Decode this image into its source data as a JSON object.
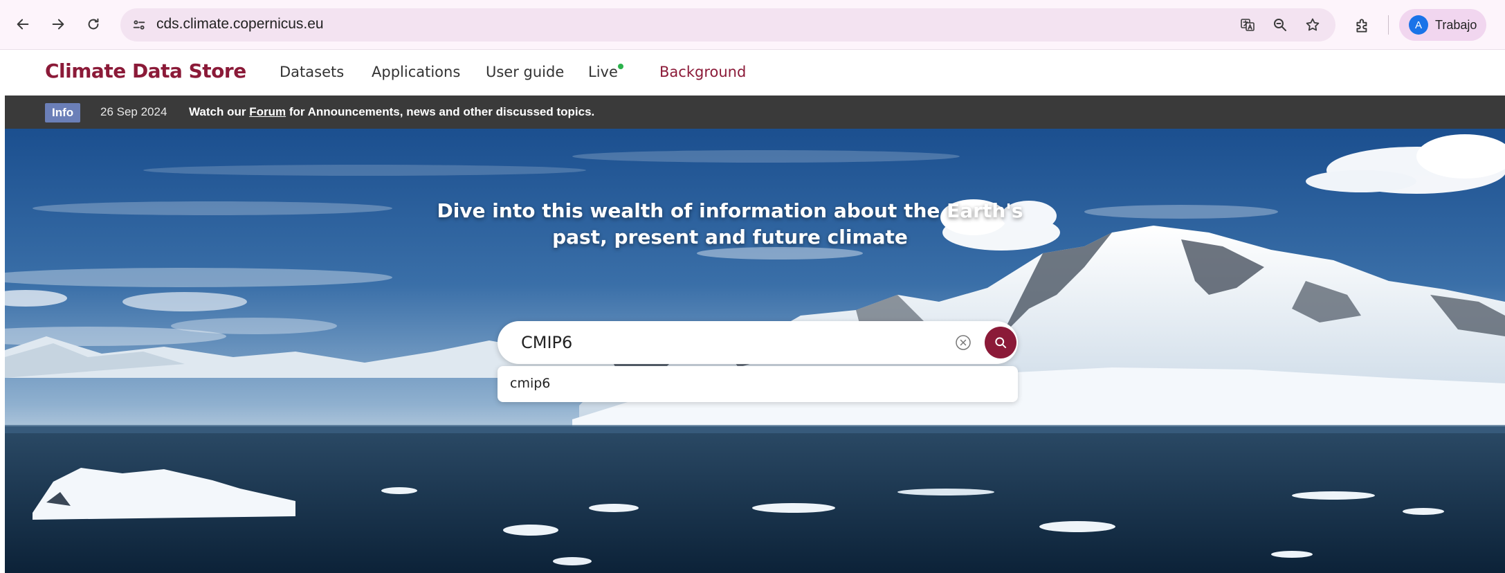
{
  "browser": {
    "url": "cds.climate.copernicus.eu",
    "profile_initial": "A",
    "profile_name": "Trabajo",
    "icons": [
      "back-arrow-icon",
      "forward-arrow-icon",
      "reload-icon",
      "site-info-icon",
      "translate-icon",
      "zoom-icon",
      "bookmark-star-icon",
      "extensions-icon"
    ]
  },
  "header": {
    "brand": "Climate Data Store",
    "nav": {
      "datasets": "Datasets",
      "applications": "Applications",
      "user_guide": "User guide",
      "live": "Live",
      "background": "Background"
    }
  },
  "info_banner": {
    "badge": "Info",
    "date": "26 Sep 2024",
    "message_prefix": "Watch our ",
    "message_link": "Forum",
    "message_suffix": " for Announcements, news and other discussed topics."
  },
  "hero": {
    "title_line1": "Dive into this wealth of information about the Earth's",
    "title_line2": "past, present and future climate",
    "search_value": "CMIP6",
    "suggestion": "cmip6"
  },
  "colors": {
    "brand": "#8b1a38",
    "live_indicator": "#2bb24c",
    "info_badge": "#6b7fb8",
    "banner_bg": "#3a3a3a"
  }
}
